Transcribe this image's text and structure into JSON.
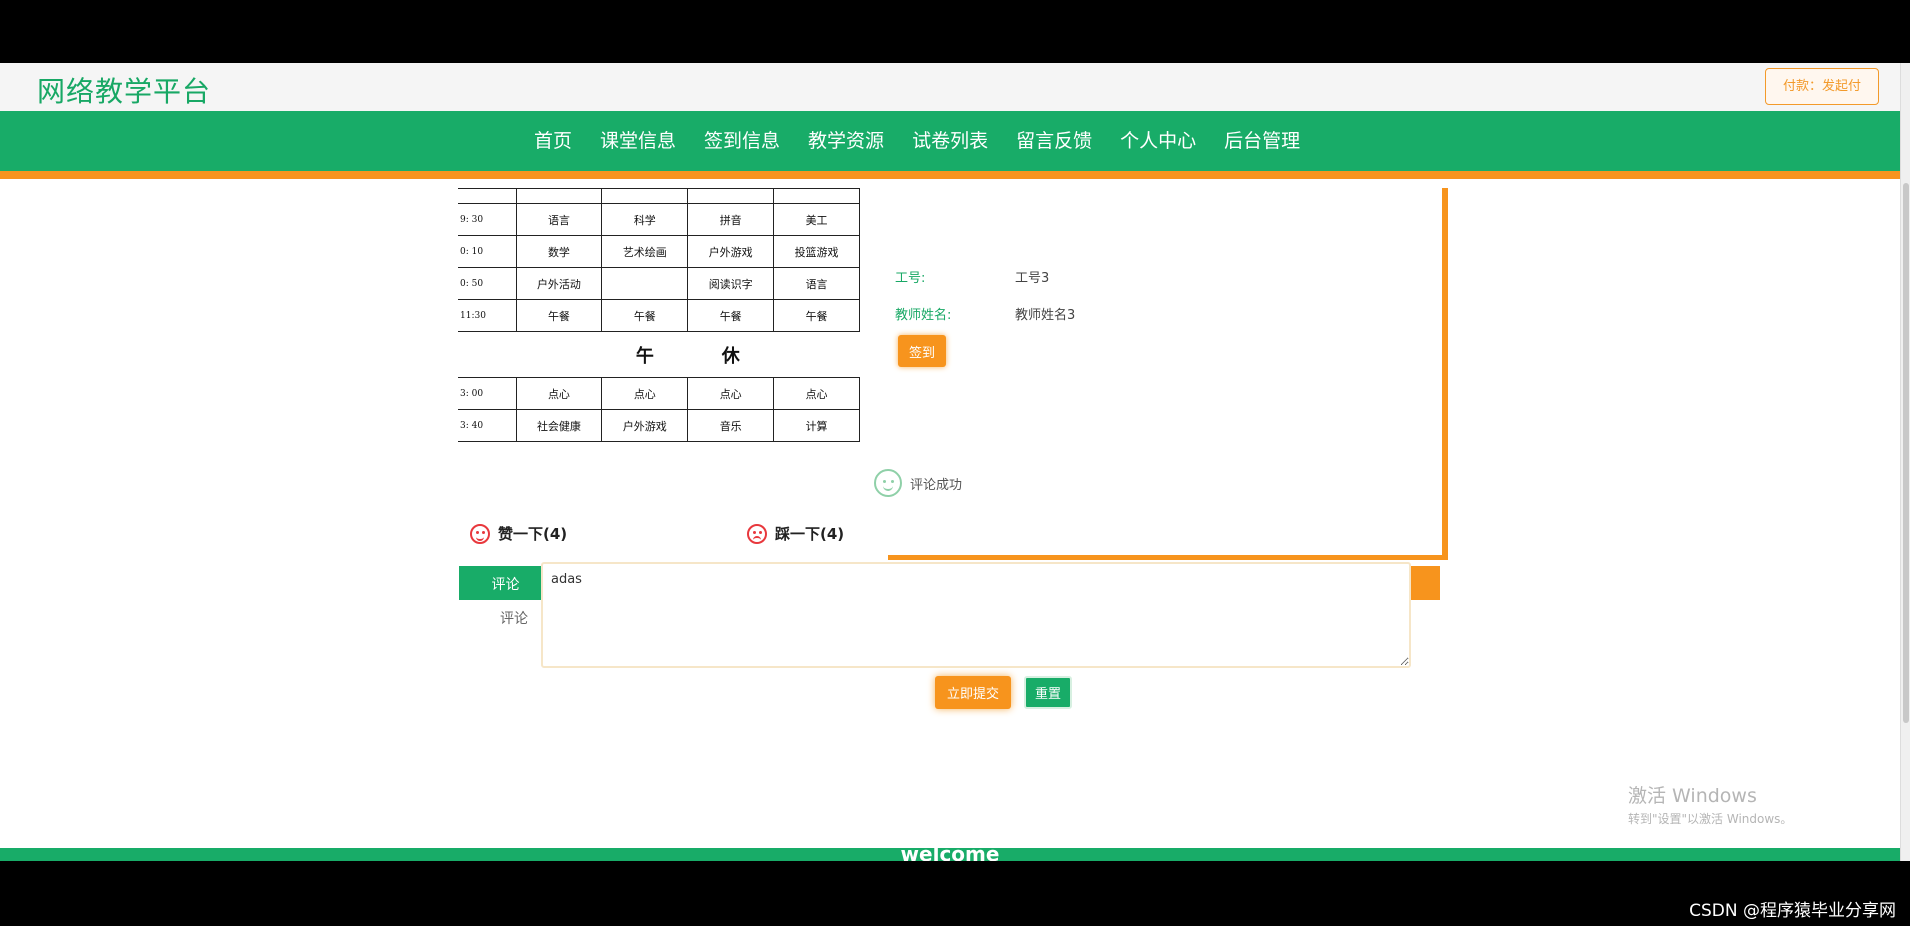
{
  "header": {
    "site_title": "网络教学平台",
    "user_button": "付款：发起付"
  },
  "nav": {
    "items": [
      "首页",
      "课堂信息",
      "签到信息",
      "教学资源",
      "试卷列表",
      "留言反馈",
      "个人中心",
      "后台管理"
    ]
  },
  "schedule": {
    "rows": [
      [
        "",
        "",
        "",
        "",
        ""
      ],
      [
        "9: 30",
        "语言",
        "科学",
        "拼音",
        "美工"
      ],
      [
        "0: 10",
        "数学",
        "艺术绘画",
        "户外游戏",
        "投篮游戏"
      ],
      [
        "0: 50",
        "户外活动",
        "",
        "阅读识字",
        "语言"
      ],
      [
        "11:30",
        "午餐",
        "午餐",
        "午餐",
        "午餐"
      ]
    ],
    "noon_left": "午",
    "noon_right": "休",
    "rows_after": [
      [
        "3: 00",
        "点心",
        "点心",
        "点心",
        "点心"
      ],
      [
        "3: 40",
        "社会健康",
        "户外游戏",
        "音乐",
        "计算"
      ]
    ]
  },
  "info": {
    "id_label": "工号:",
    "id_value": "工号3",
    "name_label": "教师姓名:",
    "name_value": "教师姓名3",
    "signin_button": "签到",
    "success_text": "评论成功"
  },
  "votes": {
    "like": "赞一下(4)",
    "dislike": "踩一下(4)"
  },
  "comment": {
    "tab_label": "评论",
    "field_label": "评论",
    "field_value": "adas",
    "submit_button": "立即提交",
    "reset_button": "重置"
  },
  "watermark": {
    "title": "激活 Windows",
    "subtitle": "转到\"设置\"以激活 Windows。"
  },
  "footer": {
    "text": "welcome"
  },
  "csdn_mark": "CSDN @程序猿毕业分享网"
}
